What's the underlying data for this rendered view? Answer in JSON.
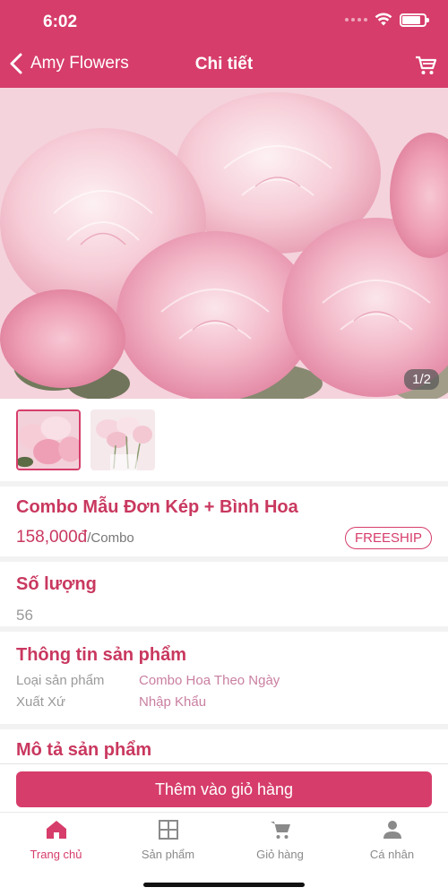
{
  "status_bar": {
    "time": "6:02"
  },
  "nav": {
    "back_label": "Amy Flowers",
    "title": "Chi tiết"
  },
  "gallery": {
    "counter": "1/2"
  },
  "product": {
    "name": "Combo Mẫu Đơn Kép + Bình Hoa",
    "price": "158,000đ",
    "unit": "/Combo",
    "badge": "FREESHIP"
  },
  "quantity": {
    "title": "Số lượng",
    "value": "56"
  },
  "info": {
    "title": "Thông tin sản phẩm",
    "rows": [
      {
        "key": "Loại sản phẩm",
        "value": "Combo Hoa Theo Ngày"
      },
      {
        "key": "Xuất Xứ",
        "value": "Nhập Khẩu"
      }
    ]
  },
  "description": {
    "title": "Mô tả sản phẩm"
  },
  "cta": {
    "label": "Thêm vào giỏ hàng"
  },
  "tabs": [
    {
      "label": "Trang chủ",
      "icon": "home-icon",
      "active": true
    },
    {
      "label": "Sản phẩm",
      "icon": "grid-icon",
      "active": false
    },
    {
      "label": "Giỏ hàng",
      "icon": "cart-icon",
      "active": false
    },
    {
      "label": "Cá nhân",
      "icon": "person-icon",
      "active": false
    }
  ],
  "colors": {
    "accent": "#d63d6b",
    "text_accent": "#c9385f",
    "muted": "#9a9a9a"
  }
}
